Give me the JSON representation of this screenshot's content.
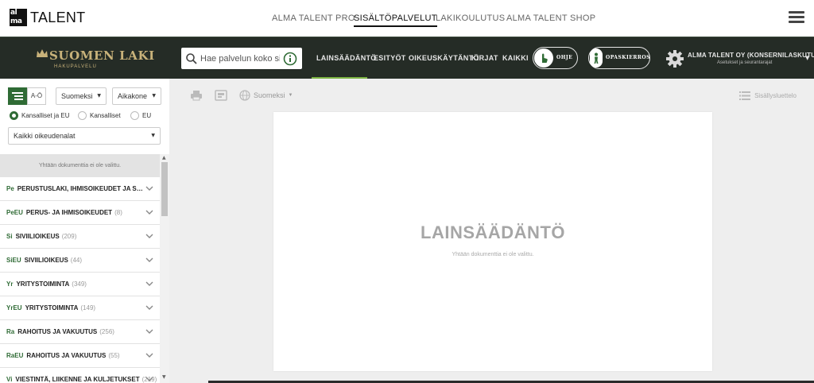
{
  "topbar": {
    "logo_mark": "al ma",
    "logo_word": "TALENT",
    "nav": [
      "ALMA TALENT PRO",
      "SISÄLTÖPALVELUT",
      "LAKIKOULUTUS",
      "ALMA TALENT SHOP"
    ],
    "active_nav": "SISÄLTÖPALVELUT"
  },
  "header": {
    "logo_title": "SUOMEN LAKI",
    "logo_subtitle": "HAKUPALVELU",
    "search_placeholder": "Hae palvelun koko sisällöstä",
    "tabs": [
      "LAINSÄÄDÄNTÖ",
      "ESITYÖT",
      "OIKEUSKÄYTÄNTÖ",
      "KIRJAT",
      "KAIKKI"
    ],
    "active_tab": "LAINSÄÄDÄNTÖ",
    "help_label": "OHJE",
    "tour_label": "OPASKIERROS",
    "account_name": "ALMA TALENT OY (KONSERNILASKUTUS)",
    "account_sub": "Asetukset ja seurantarajat"
  },
  "sidebar": {
    "view_btn_alpha": "A-Ö",
    "language_select": "Suomeksi",
    "sort_select": "Aikakone",
    "radios": [
      {
        "label": "Kansalliset ja EU",
        "checked": true
      },
      {
        "label": "Kansalliset",
        "checked": false
      },
      {
        "label": "EU",
        "checked": false
      }
    ],
    "area_select": "Kaikki oikeudenalat",
    "no_doc": "Yhtään dokumenttia ei ole valittu.",
    "categories": [
      {
        "code": "Pe",
        "name": "PERUSTUSLAKI, IHMISOIKEUDET JA SYRJIMÄTTÖMYYS",
        "count": ""
      },
      {
        "code": "PeEU",
        "name": "PERUS- JA IHMISOIKEUDET",
        "count": "(8)"
      },
      {
        "code": "Si",
        "name": "SIVIILIOIKEUS",
        "count": "(209)"
      },
      {
        "code": "SiEU",
        "name": "SIVIILIOIKEUS",
        "count": "(44)"
      },
      {
        "code": "Yr",
        "name": "YRITYSTOIMINTA",
        "count": "(349)"
      },
      {
        "code": "YrEU",
        "name": "YRITYSTOIMINTA",
        "count": "(149)"
      },
      {
        "code": "Ra",
        "name": "RAHOITUS JA VAKUUTUS",
        "count": "(256)"
      },
      {
        "code": "RaEU",
        "name": "RAHOITUS JA VAKUUTUS",
        "count": "(55)"
      },
      {
        "code": "Vi",
        "name": "VIESTINTÄ, LIIKENNE JA KULJETUKSET",
        "count": "(219)"
      }
    ]
  },
  "main": {
    "language": "Suomeksi",
    "toc_label": "Sisällysluettelo",
    "doc_title": "LAINSÄÄDÄNTÖ",
    "doc_subtitle": "Yhtään dokumenttia ei ole valittu."
  },
  "colors": {
    "header_bg": "#252c26",
    "accent_green": "#2f6b35",
    "tab_underline": "#7cb342",
    "logo_gold": "#c8b27a"
  }
}
